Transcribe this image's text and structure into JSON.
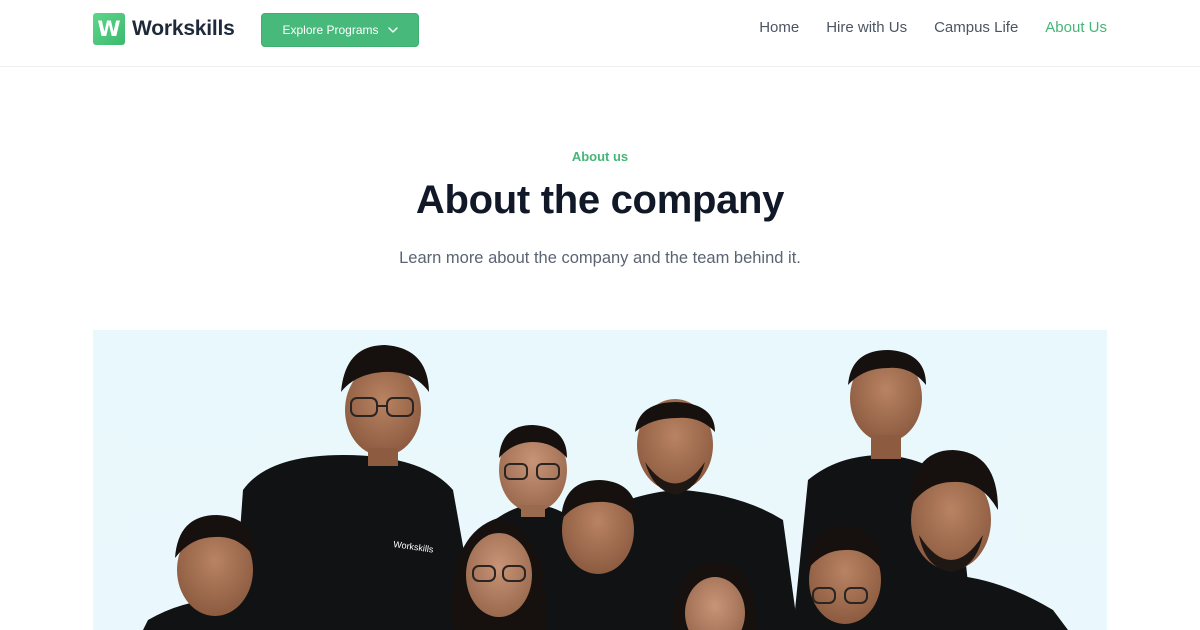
{
  "header": {
    "logo_letter": "W",
    "logo_text": "Workskills",
    "explore_button": "Explore Programs",
    "nav": [
      {
        "label": "Home",
        "active": false
      },
      {
        "label": "Hire with Us",
        "active": false
      },
      {
        "label": "Campus Life",
        "active": false
      },
      {
        "label": "About Us",
        "active": true
      }
    ]
  },
  "hero": {
    "eyebrow": "About us",
    "title": "About the company",
    "subtitle": "Learn more about the company and the team behind it."
  },
  "photo": {
    "shirt_logo_text": "Workskills"
  },
  "colors": {
    "accent": "#45b676",
    "button": "#47b97a",
    "title": "#111827",
    "photo_bg": "#e9f8fc"
  }
}
